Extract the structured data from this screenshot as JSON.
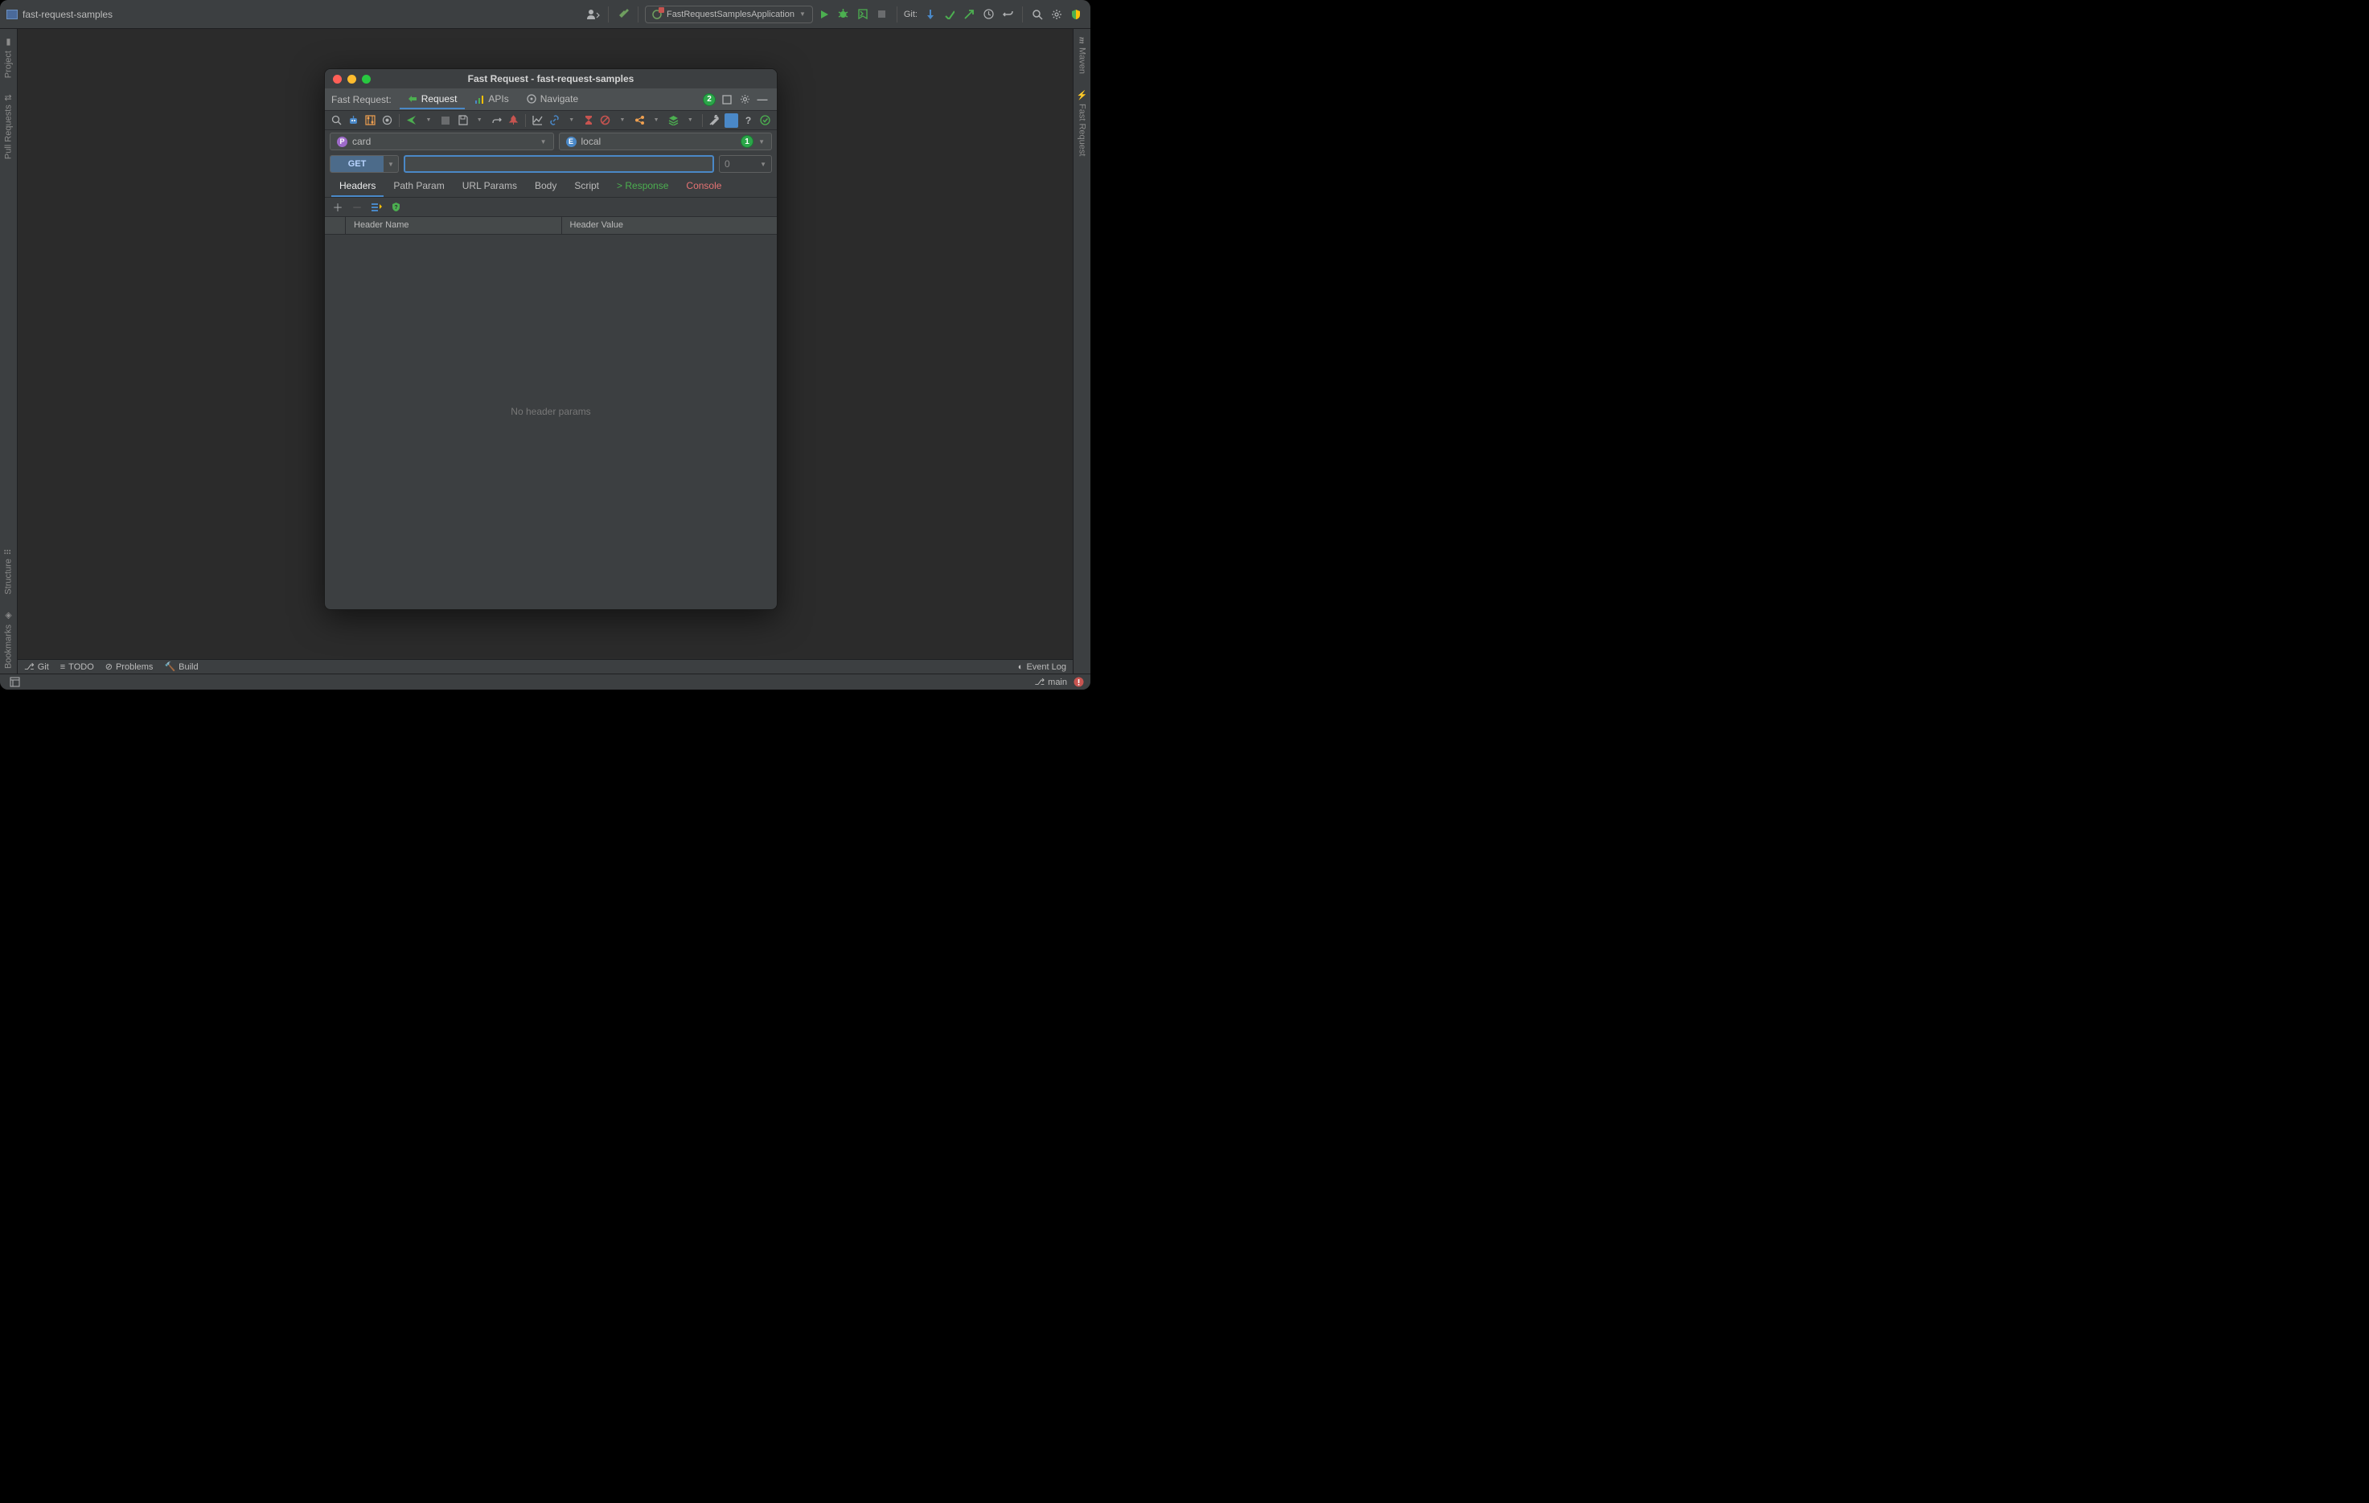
{
  "project": {
    "name": "fast-request-samples"
  },
  "topbar": {
    "run_config": "FastRequestSamplesApplication",
    "git_label": "Git:"
  },
  "left_gutter": {
    "project": "Project",
    "pull_requests": "Pull Requests",
    "structure": "Structure",
    "bookmarks": "Bookmarks"
  },
  "right_gutter": {
    "maven": "Maven",
    "fast_request": "Fast Request"
  },
  "bottom_bar": {
    "git": "Git",
    "todo": "TODO",
    "problems": "Problems",
    "build": "Build",
    "event_log": "Event Log"
  },
  "status": {
    "branch": "main"
  },
  "popup": {
    "title": "Fast Request - fast-request-samples",
    "tabbar_label": "Fast Request:",
    "tabs": {
      "request": "Request",
      "apis": "APIs",
      "navigate": "Navigate"
    },
    "badge2": "2",
    "selectors": {
      "project": "card",
      "env": "local",
      "badge1": "1"
    },
    "request_line": {
      "method": "GET",
      "url": "",
      "count": "0"
    },
    "subtabs": {
      "headers": "Headers",
      "path_param": "Path Param",
      "url_params": "URL Params",
      "body": "Body",
      "script": "Script",
      "response": "> Response",
      "console": "Console"
    },
    "table": {
      "col_name": "Header Name",
      "col_value": "Header Value",
      "empty": "No header params"
    }
  }
}
